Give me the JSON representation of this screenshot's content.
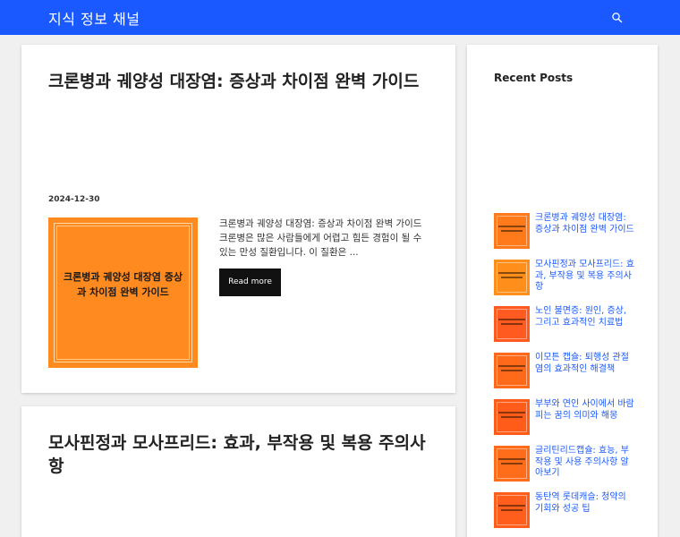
{
  "header": {
    "site_title": "지식 정보 채널",
    "search_icon": "search-icon",
    "bg_color": "#1a59ff"
  },
  "posts": [
    {
      "title": "크론병과 궤양성 대장염: 증상과 차이점 완벽 가이드",
      "date": "2024-12-30",
      "thumb_text": "크론병과 궤양성 대장염 증상과 차이점 완벽 가이드",
      "excerpt": "크론병과 궤양성 대장염: 증상과 차이점 완벽 가이드 크론병은 많은 사람들에게 어렵고 힘든 경험이 될 수 있는 만성 질환입니다. 이 질환은 ...",
      "read_more": "Read more"
    },
    {
      "title": "모사핀정과 모사프리드: 효과, 부작용 및 복용 주의사항"
    }
  ],
  "sidebar": {
    "heading": "Recent Posts",
    "items": [
      {
        "title": "크론병과 궤양성 대장염: 증상과 차이점 완벽 가이드",
        "color": "#ff7a1a"
      },
      {
        "title": "모사핀정과 모사프리드: 효과, 부작용 및 복용 주의사항",
        "color": "#ff8f1a"
      },
      {
        "title": "노인 불면증: 원인, 증상, 그리고 효과적인 치료법",
        "color": "#ff5a1f"
      },
      {
        "title": "이모튼 캡슐: 퇴행성 관절염의 효과적인 해결책",
        "color": "#ff6a1a"
      },
      {
        "title": "부부와 연인 사이에서 바람피는 꿈의 의미와 해몽",
        "color": "#ff5c1a"
      },
      {
        "title": "글리틴리드캡슐: 효능, 부작용 및 사용 주의사항 알아보기",
        "color": "#ff6c1a"
      },
      {
        "title": "동탄역 롯데캐슬: 청약의 기회와 성공 팁",
        "color": "#ff5e1c"
      }
    ]
  }
}
